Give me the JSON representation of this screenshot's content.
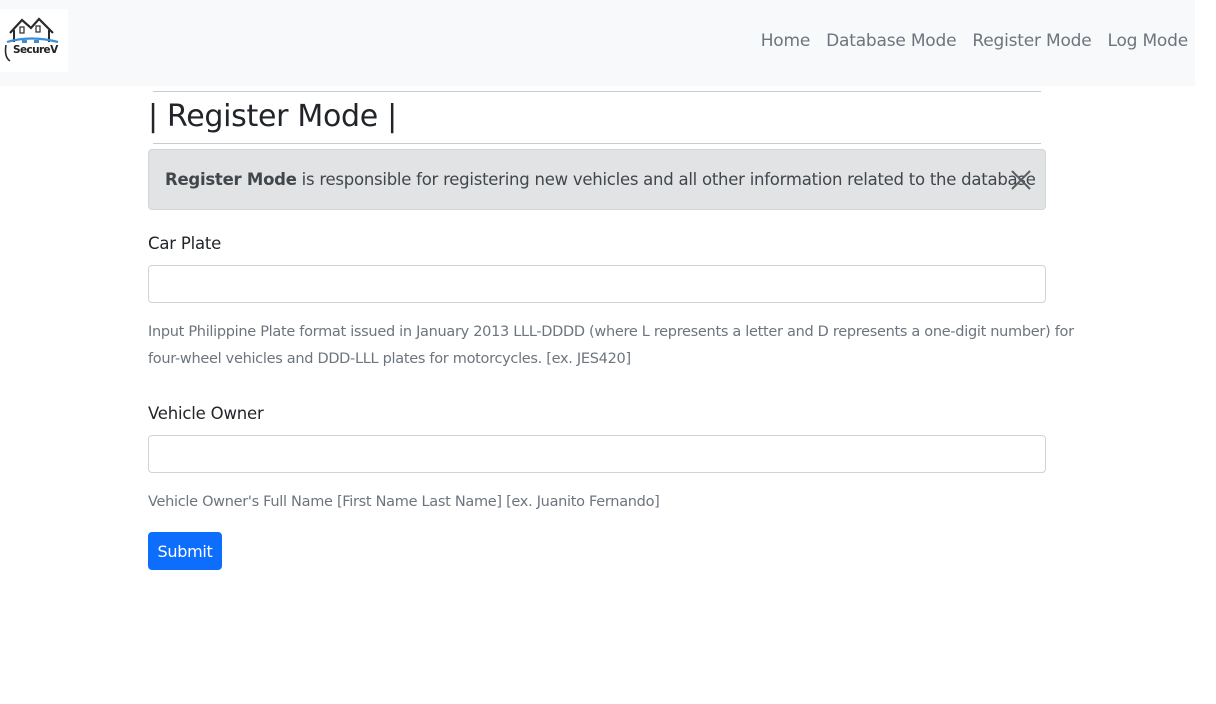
{
  "navbar": {
    "brand_text": "SecureV",
    "links": [
      {
        "label": "Home"
      },
      {
        "label": "Database Mode"
      },
      {
        "label": "Register Mode"
      },
      {
        "label": "Log Mode"
      }
    ]
  },
  "page": {
    "heading": "| Register Mode |"
  },
  "alert": {
    "strong": "Register Mode",
    "text": " is responsible for registering new vehicles and all other information related to the database",
    "close_icon": "close-icon"
  },
  "form": {
    "car_plate": {
      "label": "Car Plate",
      "value": "",
      "help_line1": "Input Philippine Plate format issued in January 2013 LLL-DDDD (where L represents a letter and D represents a one-digit number) for",
      "help_line2": "four-wheel vehicles and DDD-LLL plates for motorcycles. [ex. JES420]"
    },
    "vehicle_owner": {
      "label": "Vehicle Owner",
      "value": "",
      "help": "Vehicle Owner's Full Name [First Name Last Name] [ex. Juanito Fernando]"
    },
    "submit_label": "Submit"
  },
  "colors": {
    "navbar_bg": "#f8f9fa",
    "primary": "#0d6efd",
    "alert_bg": "#e2e3e5",
    "muted": "#6c757d"
  }
}
